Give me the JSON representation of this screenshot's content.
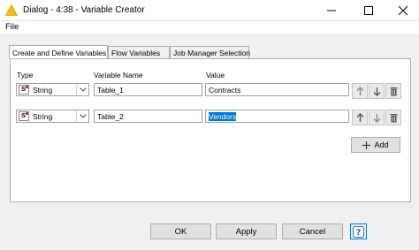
{
  "window": {
    "title": "Dialog - 4:38 - Variable Creator",
    "icon": "warning-triangle-icon"
  },
  "menu": {
    "file": "File"
  },
  "tabs": [
    {
      "label": "Create and Define Variables",
      "active": true
    },
    {
      "label": "Flow Variables",
      "active": false
    },
    {
      "label": "Job Manager Selection",
      "active": false
    }
  ],
  "columns": {
    "type": "Type",
    "name": "Variable Name",
    "value": "Value"
  },
  "rows": [
    {
      "type": "String",
      "name": "Table_1",
      "value": "Contracts"
    },
    {
      "type": "String",
      "name": "Table_2",
      "value": "Vendors"
    }
  ],
  "buttons": {
    "add": "Add",
    "ok": "OK",
    "apply": "Apply",
    "cancel": "Cancel",
    "help": "?"
  }
}
